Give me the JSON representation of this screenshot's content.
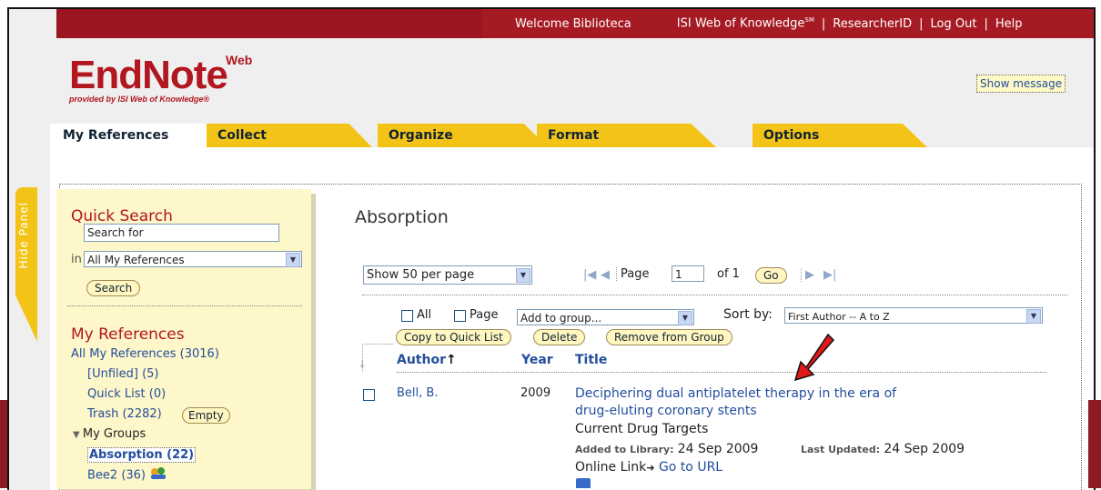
{
  "topbar": {
    "welcome": "Welcome Biblioteca",
    "wok": "ISI Web of Knowledge",
    "wok_sup": "SM",
    "researcherid": "ResearcherID",
    "logout": "Log Out",
    "help": "Help"
  },
  "logo": {
    "main": "EndNote",
    "sup": "Web",
    "tagline": "provided by ISI Web of Knowledge®"
  },
  "show_message": "Show message",
  "tabs": [
    {
      "label": "My References"
    },
    {
      "label": "Collect"
    },
    {
      "label": "Organize"
    },
    {
      "label": "Format"
    },
    {
      "label": "Options"
    }
  ],
  "hide_panel": "Hide Panel",
  "quick_search": {
    "title": "Quick Search",
    "input_value": "Search for",
    "in_label": "in",
    "scope": "All My References",
    "button": "Search"
  },
  "my_references": {
    "title": "My References",
    "all": "All My References (3016)",
    "unfiled": "[Unfiled] (5)",
    "quick_list": "Quick List (0)",
    "trash": "Trash (2282)",
    "empty_button": "Empty",
    "my_groups": "My Groups",
    "groups": [
      "Absorption (22)",
      "Bee2 (36)"
    ]
  },
  "main": {
    "title": "Absorption",
    "per_page": "Show 50 per page",
    "page_label": "Page",
    "page_value": "1",
    "of_label": "of 1",
    "go": "Go",
    "all_label": "All",
    "page_check_label": "Page",
    "add_to_group": "Add to group...",
    "sort_label": "Sort by:",
    "sort_value": "First Author -- A to Z",
    "copy_quick": "Copy to Quick List",
    "delete": "Delete",
    "remove_group": "Remove from Group",
    "col_author": "Author",
    "col_year": "Year",
    "col_title": "Title"
  },
  "reference": {
    "author": "Bell, B.",
    "year": "2009",
    "title_line1": "Deciphering dual antiplatelet therapy in the era of",
    "title_line2": "drug-eluting coronary stents",
    "journal": "Current Drug Targets",
    "added_label": "Added to Library:",
    "added_date": "24 Sep 2009",
    "updated_label": "Last Updated:",
    "updated_date": "24 Sep 2009",
    "online_link": "Online Link",
    "go_to_url": "Go to URL"
  },
  "colors": {
    "brand_red": "#b2161f",
    "tab_yellow": "#f3c417",
    "link_blue": "#244e9c",
    "panel_bg": "#fdf7c9"
  }
}
